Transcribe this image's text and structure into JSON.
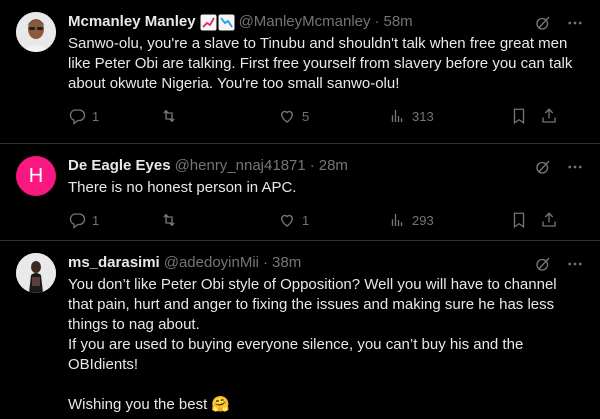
{
  "tweets": [
    {
      "name": "Mcmanley Manley",
      "handle": "@ManleyMcmanley",
      "time": "58m",
      "text": "Sanwo-olu, you're a slave to Tinubu and shouldn't talk when free great men like Peter Obi are talking. First free yourself from slavery before you can talk about okwute Nigeria. You're too small sanwo-olu!",
      "replies": "1",
      "retweets": "",
      "likes": "5",
      "views": "313"
    },
    {
      "name": "De Eagle Eyes",
      "handle": "@henry_nnaj41871",
      "time": "28m",
      "avatar_letter": "H",
      "text": "There is no honest person in APC.",
      "replies": "1",
      "retweets": "",
      "likes": "1",
      "views": "293"
    },
    {
      "name": "ms_darasimi",
      "handle": "@adedoyinMii",
      "time": "38m",
      "text": "You don’t like Peter Obi style of Opposition? Well you will have to channel that pain, hurt and anger to fixing the issues and making sure he has less things to nag about.\nIf you are used to buying everyone silence, you can’t buy his and the OBIdients!\n\nWishing you the best 🤗"
    }
  ],
  "colors": {
    "background": "#000000",
    "text": "#e7e9ea",
    "muted": "#71767b",
    "border": "#2f3336",
    "avatar_h": "#f91880"
  },
  "icons": [
    "grok-icon",
    "more-icon",
    "reply-icon",
    "retweet-icon",
    "like-icon",
    "views-icon",
    "bookmark-icon",
    "share-icon",
    "chart-up-emoji",
    "chart-down-emoji"
  ]
}
